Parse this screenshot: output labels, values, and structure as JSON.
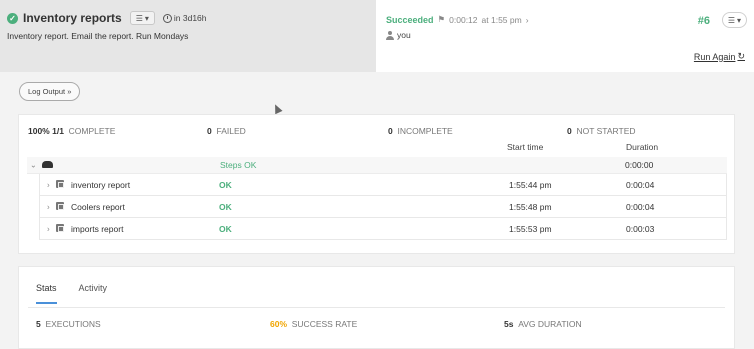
{
  "job": {
    "title": "Inventory reports",
    "next_run": "in 3d16h",
    "description": "Inventory report. Email the report. Run Mondays"
  },
  "execution": {
    "status": "Succeeded",
    "duration": "0:00:12",
    "time": "at 1:55 pm",
    "user": "you",
    "number": "#6",
    "run_again": "Run Again"
  },
  "log_button": "Log Output »",
  "summary": {
    "complete_value": "100% 1/1",
    "complete_label": "COMPLETE",
    "failed_value": "0",
    "failed_label": "FAILED",
    "incomplete_value": "0",
    "incomplete_label": "INCOMPLETE",
    "not_started_value": "0",
    "not_started_label": "NOT STARTED"
  },
  "columns": {
    "start_time": "Start time",
    "duration": "Duration"
  },
  "node": {
    "status": "Steps OK",
    "duration": "0:00:00"
  },
  "steps": [
    {
      "name": "inventory report",
      "status": "OK",
      "start": "1:55:44 pm",
      "duration": "0:00:04"
    },
    {
      "name": "Coolers report",
      "status": "OK",
      "start": "1:55:48 pm",
      "duration": "0:00:04"
    },
    {
      "name": "imports report",
      "status": "OK",
      "start": "1:55:53 pm",
      "duration": "0:00:03"
    }
  ],
  "tabs": [
    "Stats",
    "Activity"
  ],
  "stats": {
    "executions_value": "5",
    "executions_label": "EXECUTIONS",
    "success_value": "60%",
    "success_label": "SUCCESS RATE",
    "avg_value": "5s",
    "avg_label": "AVG DURATION"
  },
  "colors": {
    "success": "#4caf7d",
    "rate": "#f0a500",
    "tab_accent": "#4a90d9"
  },
  "icons": [
    "check-circle-icon",
    "list-menu-icon",
    "clock-icon",
    "flag-icon",
    "chevron-right-icon",
    "user-icon",
    "refresh-icon",
    "chevron-down-icon",
    "node-icon",
    "job-icon"
  ]
}
